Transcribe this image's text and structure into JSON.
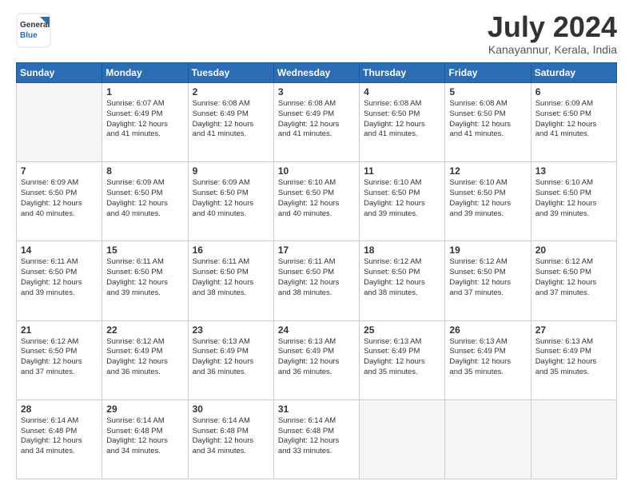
{
  "logo": {
    "general": "General",
    "blue": "Blue"
  },
  "title": {
    "month_year": "July 2024",
    "location": "Kanayannur, Kerala, India"
  },
  "headers": [
    "Sunday",
    "Monday",
    "Tuesday",
    "Wednesday",
    "Thursday",
    "Friday",
    "Saturday"
  ],
  "weeks": [
    [
      {
        "day": "",
        "info": ""
      },
      {
        "day": "1",
        "info": "Sunrise: 6:07 AM\nSunset: 6:49 PM\nDaylight: 12 hours\nand 41 minutes."
      },
      {
        "day": "2",
        "info": "Sunrise: 6:08 AM\nSunset: 6:49 PM\nDaylight: 12 hours\nand 41 minutes."
      },
      {
        "day": "3",
        "info": "Sunrise: 6:08 AM\nSunset: 6:49 PM\nDaylight: 12 hours\nand 41 minutes."
      },
      {
        "day": "4",
        "info": "Sunrise: 6:08 AM\nSunset: 6:50 PM\nDaylight: 12 hours\nand 41 minutes."
      },
      {
        "day": "5",
        "info": "Sunrise: 6:08 AM\nSunset: 6:50 PM\nDaylight: 12 hours\nand 41 minutes."
      },
      {
        "day": "6",
        "info": "Sunrise: 6:09 AM\nSunset: 6:50 PM\nDaylight: 12 hours\nand 41 minutes."
      }
    ],
    [
      {
        "day": "7",
        "info": "Sunrise: 6:09 AM\nSunset: 6:50 PM\nDaylight: 12 hours\nand 40 minutes."
      },
      {
        "day": "8",
        "info": "Sunrise: 6:09 AM\nSunset: 6:50 PM\nDaylight: 12 hours\nand 40 minutes."
      },
      {
        "day": "9",
        "info": "Sunrise: 6:09 AM\nSunset: 6:50 PM\nDaylight: 12 hours\nand 40 minutes."
      },
      {
        "day": "10",
        "info": "Sunrise: 6:10 AM\nSunset: 6:50 PM\nDaylight: 12 hours\nand 40 minutes."
      },
      {
        "day": "11",
        "info": "Sunrise: 6:10 AM\nSunset: 6:50 PM\nDaylight: 12 hours\nand 39 minutes."
      },
      {
        "day": "12",
        "info": "Sunrise: 6:10 AM\nSunset: 6:50 PM\nDaylight: 12 hours\nand 39 minutes."
      },
      {
        "day": "13",
        "info": "Sunrise: 6:10 AM\nSunset: 6:50 PM\nDaylight: 12 hours\nand 39 minutes."
      }
    ],
    [
      {
        "day": "14",
        "info": "Sunrise: 6:11 AM\nSunset: 6:50 PM\nDaylight: 12 hours\nand 39 minutes."
      },
      {
        "day": "15",
        "info": "Sunrise: 6:11 AM\nSunset: 6:50 PM\nDaylight: 12 hours\nand 39 minutes."
      },
      {
        "day": "16",
        "info": "Sunrise: 6:11 AM\nSunset: 6:50 PM\nDaylight: 12 hours\nand 38 minutes."
      },
      {
        "day": "17",
        "info": "Sunrise: 6:11 AM\nSunset: 6:50 PM\nDaylight: 12 hours\nand 38 minutes."
      },
      {
        "day": "18",
        "info": "Sunrise: 6:12 AM\nSunset: 6:50 PM\nDaylight: 12 hours\nand 38 minutes."
      },
      {
        "day": "19",
        "info": "Sunrise: 6:12 AM\nSunset: 6:50 PM\nDaylight: 12 hours\nand 37 minutes."
      },
      {
        "day": "20",
        "info": "Sunrise: 6:12 AM\nSunset: 6:50 PM\nDaylight: 12 hours\nand 37 minutes."
      }
    ],
    [
      {
        "day": "21",
        "info": "Sunrise: 6:12 AM\nSunset: 6:50 PM\nDaylight: 12 hours\nand 37 minutes."
      },
      {
        "day": "22",
        "info": "Sunrise: 6:12 AM\nSunset: 6:49 PM\nDaylight: 12 hours\nand 36 minutes."
      },
      {
        "day": "23",
        "info": "Sunrise: 6:13 AM\nSunset: 6:49 PM\nDaylight: 12 hours\nand 36 minutes."
      },
      {
        "day": "24",
        "info": "Sunrise: 6:13 AM\nSunset: 6:49 PM\nDaylight: 12 hours\nand 36 minutes."
      },
      {
        "day": "25",
        "info": "Sunrise: 6:13 AM\nSunset: 6:49 PM\nDaylight: 12 hours\nand 35 minutes."
      },
      {
        "day": "26",
        "info": "Sunrise: 6:13 AM\nSunset: 6:49 PM\nDaylight: 12 hours\nand 35 minutes."
      },
      {
        "day": "27",
        "info": "Sunrise: 6:13 AM\nSunset: 6:49 PM\nDaylight: 12 hours\nand 35 minutes."
      }
    ],
    [
      {
        "day": "28",
        "info": "Sunrise: 6:14 AM\nSunset: 6:48 PM\nDaylight: 12 hours\nand 34 minutes."
      },
      {
        "day": "29",
        "info": "Sunrise: 6:14 AM\nSunset: 6:48 PM\nDaylight: 12 hours\nand 34 minutes."
      },
      {
        "day": "30",
        "info": "Sunrise: 6:14 AM\nSunset: 6:48 PM\nDaylight: 12 hours\nand 34 minutes."
      },
      {
        "day": "31",
        "info": "Sunrise: 6:14 AM\nSunset: 6:48 PM\nDaylight: 12 hours\nand 33 minutes."
      },
      {
        "day": "",
        "info": ""
      },
      {
        "day": "",
        "info": ""
      },
      {
        "day": "",
        "info": ""
      }
    ]
  ]
}
